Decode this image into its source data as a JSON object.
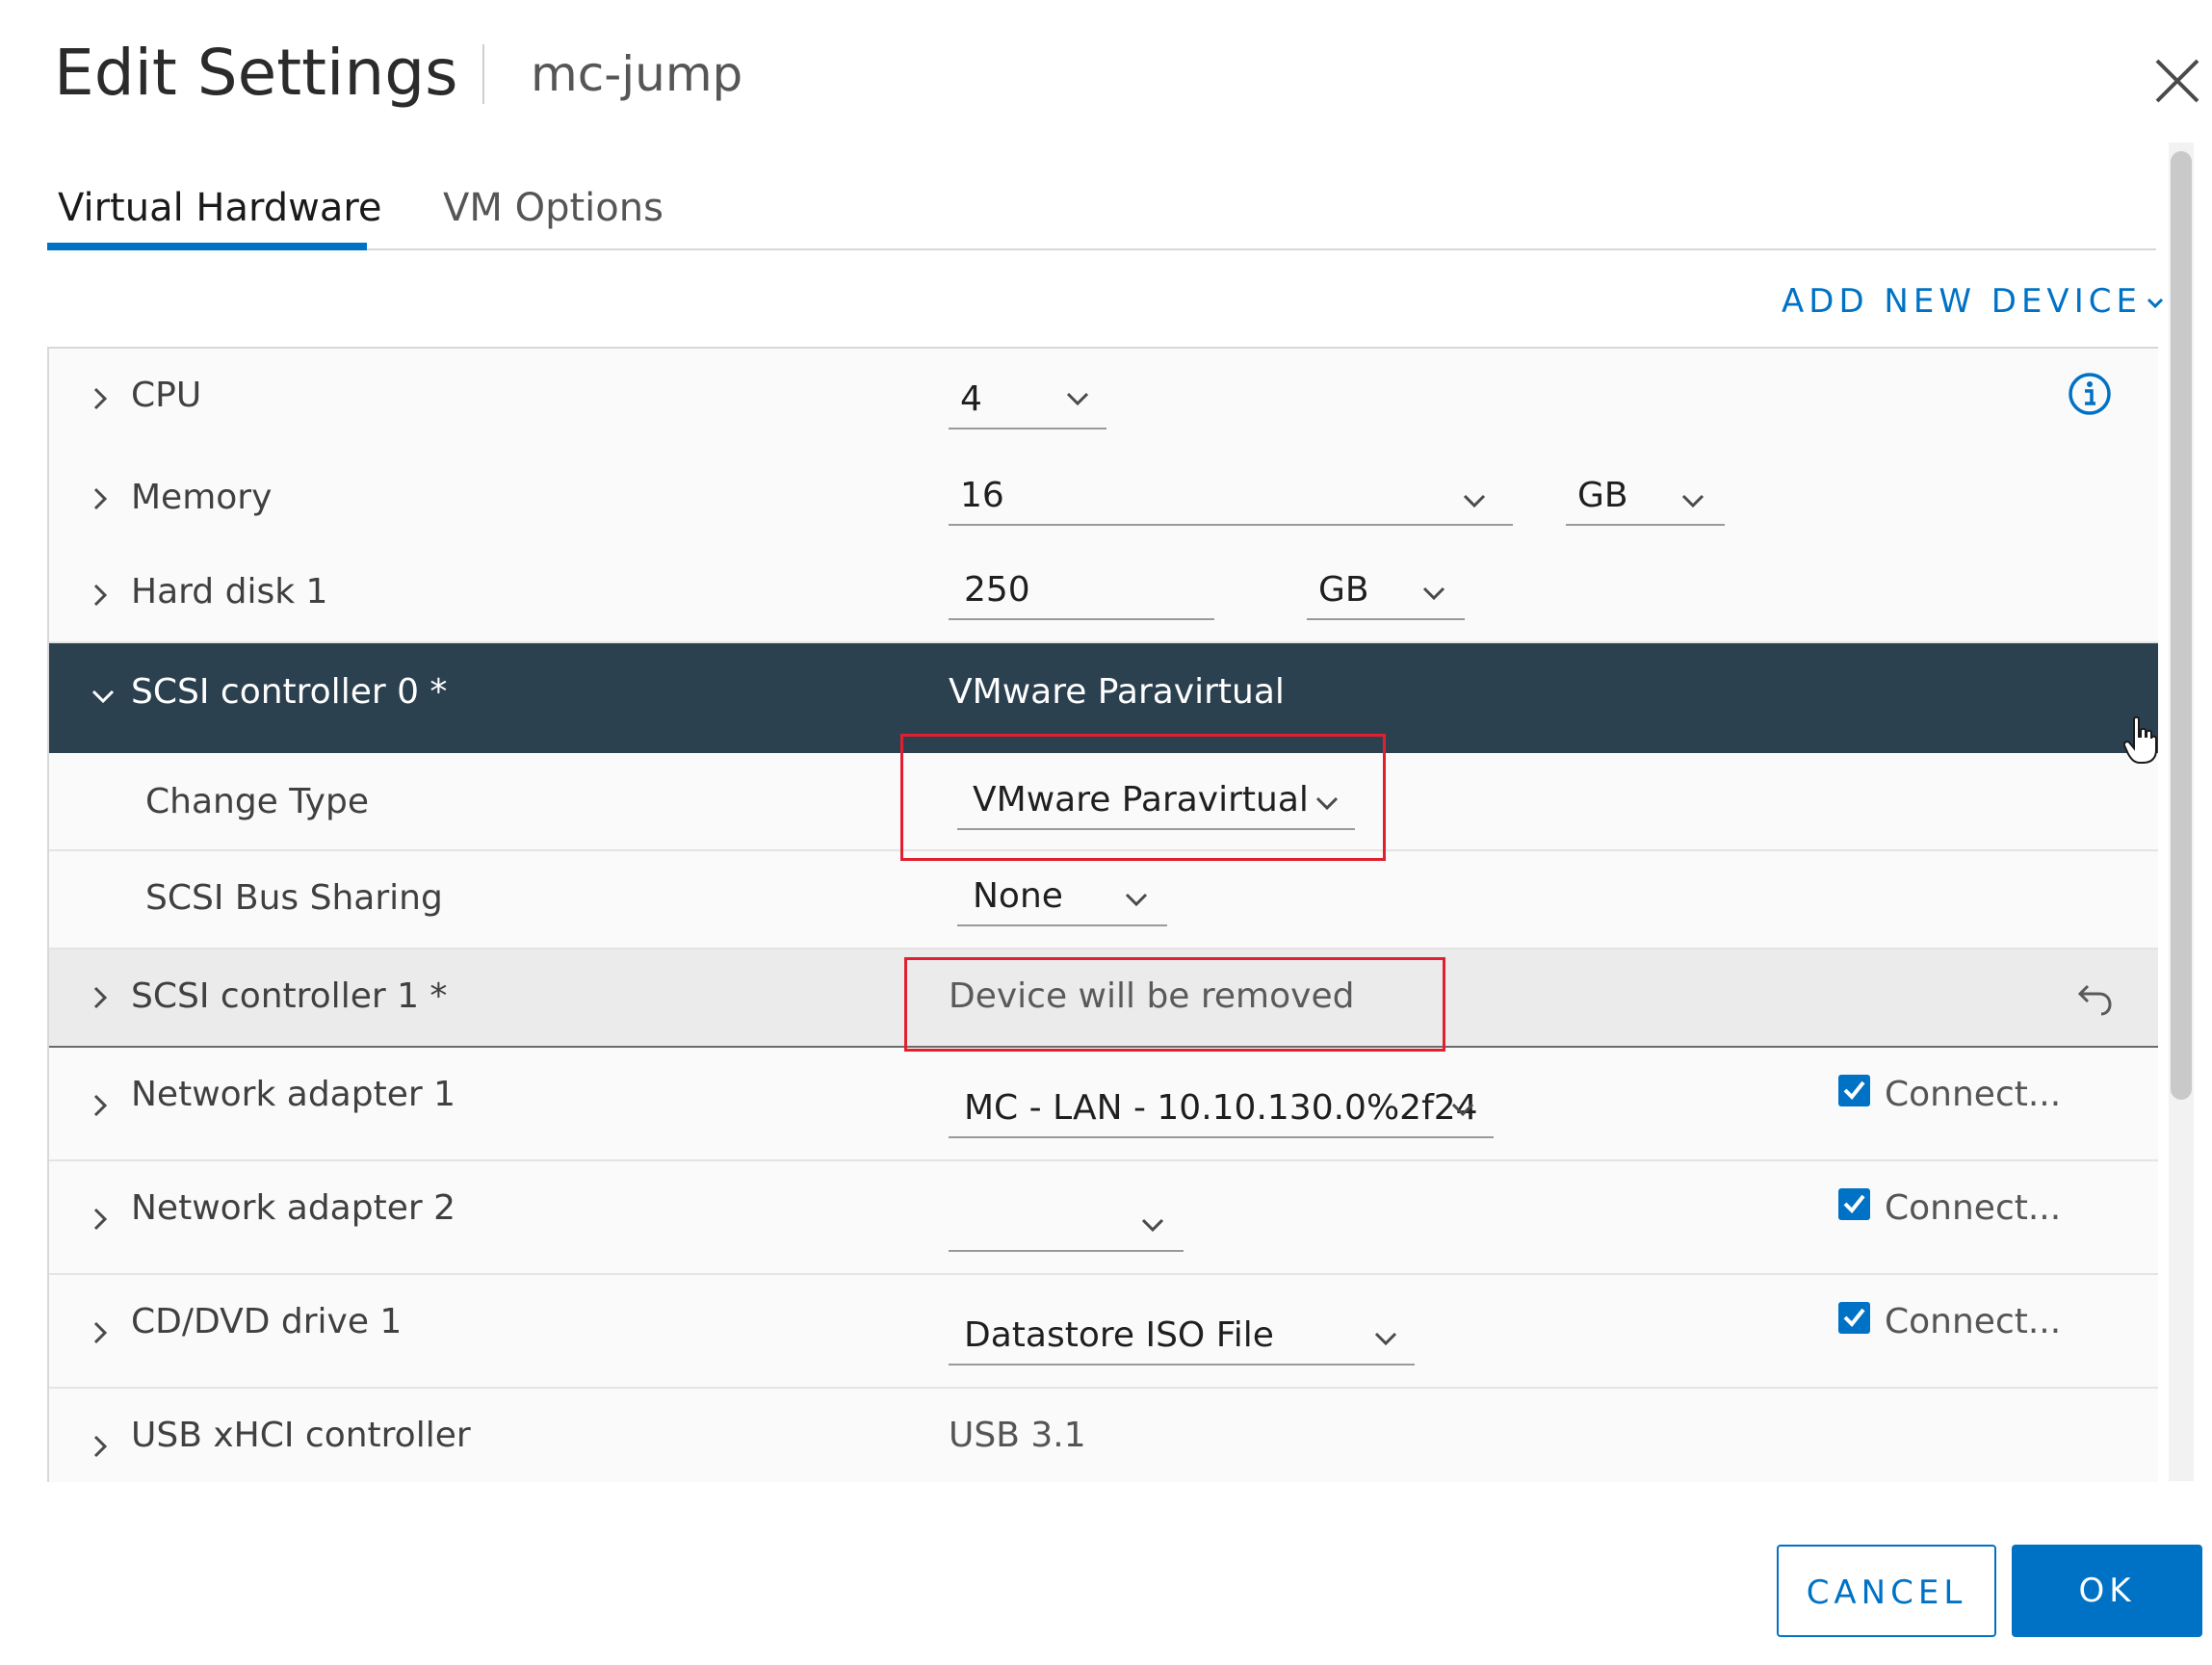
{
  "dialog": {
    "title": "Edit Settings",
    "vm_name": "mc-jump"
  },
  "tabs": [
    {
      "label": "Virtual Hardware",
      "active": true
    },
    {
      "label": "VM Options",
      "active": false
    }
  ],
  "add_device_label": "ADD NEW DEVICE",
  "rows": {
    "cpu": {
      "label": "CPU",
      "value": "4"
    },
    "memory": {
      "label": "Memory",
      "value": "16",
      "unit": "GB"
    },
    "hard_disk_1": {
      "label": "Hard disk 1",
      "value": "250",
      "unit": "GB"
    },
    "scsi0": {
      "label": "SCSI controller 0 *",
      "value": "VMware Paravirtual",
      "change_type": {
        "label": "Change Type",
        "value": "VMware Paravirtual"
      },
      "bus_sharing": {
        "label": "SCSI Bus Sharing",
        "value": "None"
      }
    },
    "scsi1": {
      "label": "SCSI controller 1 *",
      "status": "Device will be removed"
    },
    "net1": {
      "label": "Network adapter 1",
      "value": "MC - LAN - 10.10.130.0%2f24",
      "connect": "Connect...",
      "connected": true
    },
    "net2": {
      "label": "Network adapter 2",
      "value": "",
      "connect": "Connect...",
      "connected": true
    },
    "cd1": {
      "label": "CD/DVD drive 1",
      "value": "Datastore ISO File",
      "connect": "Connect...",
      "connected": true
    },
    "usb": {
      "label": "USB xHCI controller",
      "value": "USB 3.1"
    }
  },
  "buttons": {
    "cancel": "CANCEL",
    "ok": "OK"
  },
  "colors": {
    "accent": "#0072c6",
    "selected_row": "#2c4150",
    "highlight_box": "#e0202e"
  }
}
